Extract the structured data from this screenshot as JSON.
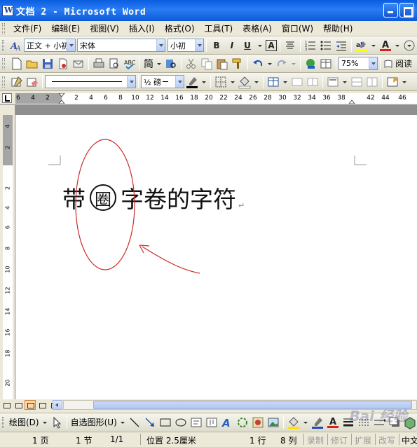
{
  "window": {
    "title": "文档 2 - Microsoft Word"
  },
  "menu": [
    "文件(F)",
    "编辑(E)",
    "视图(V)",
    "插入(I)",
    "格式(O)",
    "工具(T)",
    "表格(A)",
    "窗口(W)",
    "帮助(H)"
  ],
  "formatting": {
    "style": "正文 + 小初",
    "font": "宋体",
    "size": "小初",
    "bold": "B",
    "italic": "I",
    "underline": "U",
    "char_border": "A",
    "font_color": "A"
  },
  "standard": {
    "simplified": "简",
    "zoom": "75%",
    "reading": "阅读"
  },
  "tables_borders": {
    "line_weight": "½ 磅"
  },
  "ruler": {
    "h_ticks": [
      "6",
      "4",
      "2",
      "2",
      "4",
      "6",
      "8",
      "10",
      "12",
      "14",
      "16",
      "18",
      "20",
      "22",
      "24",
      "26",
      "28",
      "30",
      "32",
      "34",
      "36",
      "38",
      "42",
      "44",
      "46"
    ],
    "v_ticks": [
      "4",
      "2",
      "2",
      "4",
      "6",
      "8",
      "10",
      "12",
      "14",
      "16",
      "18",
      "20"
    ]
  },
  "document": {
    "text_before": "带",
    "enclosed_char": "圈",
    "text_after": "字卷的字符",
    "para_mark": "↵"
  },
  "drawing": {
    "draw_label": "绘图(D)",
    "autoshapes_label": "自选图形(U)"
  },
  "status": {
    "page": "1 页",
    "section": "1 节",
    "pages": "1/1",
    "position": "位置 2.5厘米",
    "line": "1 行",
    "column": "8 列",
    "rec": "录制",
    "trk": "修订",
    "ext": "扩展",
    "ovr": "改写",
    "lang": "中文"
  },
  "colors": {
    "annotation": "#cc2a2a",
    "titlebar": "#0a5ee0"
  }
}
